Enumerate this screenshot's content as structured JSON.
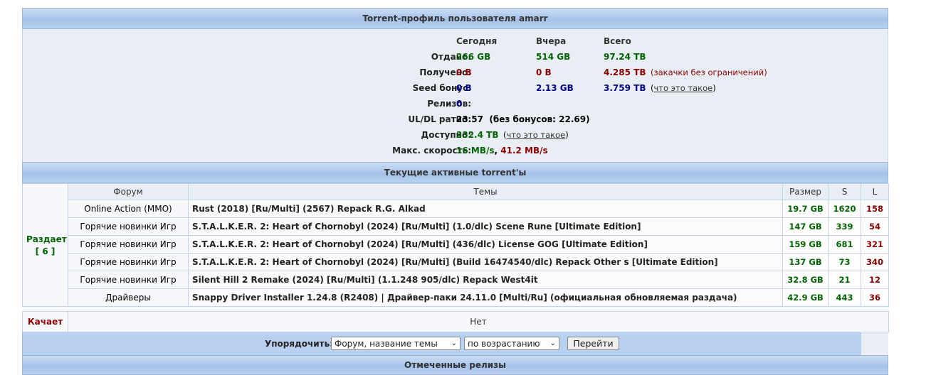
{
  "profile": {
    "title": "Torrent-профиль пользователя amarr",
    "headers": {
      "today": "Сегодня",
      "yesterday": "Вчера",
      "total": "Всего"
    },
    "uploaded": {
      "label": "Отдано:",
      "today": "266 GB",
      "yesterday": "514 GB",
      "total": "97.24 TB"
    },
    "downloaded": {
      "label": "Получено:",
      "today": "0 B",
      "yesterday": "0 B",
      "total": "4.285 TB",
      "note": "(закачки без ограничений)"
    },
    "seed_bonus": {
      "label": "Seed бонус:",
      "today": "0 B",
      "yesterday": "2.13 GB",
      "total": "3.759 TB",
      "note_open": "(",
      "note_link": "что это такое",
      "note_close": ")"
    },
    "releases": {
      "label": "Релизов:",
      "value": "0"
    },
    "ratio": {
      "label": "UL/DL ратио:",
      "value": "23.57",
      "extra": "(без бонусов: 22.69)"
    },
    "available": {
      "label": "Доступно:",
      "value": "332.4 TB",
      "note_open": "(",
      "note_link": "что это такое",
      "note_close": ")"
    },
    "max_speed": {
      "label": "Макс. скорость:",
      "up": "16 MB/s",
      "sep": ",",
      "down": "41.2 MB/s"
    }
  },
  "active": {
    "title": "Текущие активные torrent'ы",
    "columns": {
      "forum": "Форум",
      "topic": "Темы",
      "size": "Размер",
      "seeders": "S",
      "leechers": "L"
    },
    "seeding_label": "Раздает",
    "seeding_count": "[ 6 ]",
    "rows": [
      {
        "forum": "Online Action (MMO)",
        "topic": "Rust (2018) [Ru/Multi] (2567) Repack R.G. Alkad",
        "size": "19.7 GB",
        "s": "1620",
        "l": "158"
      },
      {
        "forum": "Горячие новинки Игр",
        "topic": "S.T.A.L.K.E.R. 2: Heart of Chornobyl (2024) [Ru/Multi] (1.0/dlc) Scene Rune [Ultimate Edition]",
        "size": "147 GB",
        "s": "339",
        "l": "54"
      },
      {
        "forum": "Горячие новинки Игр",
        "topic": "S.T.A.L.K.E.R. 2: Heart of Chornobyl (2024) [Ru/Multi] (436/dlc) License GOG [Ultimate Edition]",
        "size": "159 GB",
        "s": "681",
        "l": "321"
      },
      {
        "forum": "Горячие новинки Игр",
        "topic": "S.T.A.L.K.E.R. 2: Heart of Chornobyl (2024) [Ru/Multi] (Build 16474540/dlc) Repack Other s [Ultimate Edition]",
        "size": "137 GB",
        "s": "73",
        "l": "340"
      },
      {
        "forum": "Горячие новинки Игр",
        "topic": "Silent Hill 2 Remake (2024) [Ru/Multi] (1.1.248 905/dlc) Repack West4it",
        "size": "32.8 GB",
        "s": "21",
        "l": "12"
      },
      {
        "forum": "Драйверы",
        "topic": "Snappy Driver Installer 1.24.8 (R2408) | Драйвер-паки 24.11.0 [Multi/Ru] (официальная обновляемая раздача)",
        "size": "42.9 GB",
        "s": "443",
        "l": "36"
      }
    ],
    "leeching_label": "Качает",
    "leeching_value": "Нет"
  },
  "order": {
    "label": "Упорядочить:",
    "sort_field": "Форум, название темы",
    "sort_dir": "по возрастанию",
    "submit": "Перейти"
  },
  "marked": {
    "title": "Отмеченные релизы"
  },
  "colors": {
    "seed_green": "#006400",
    "leech_red": "#8b0000",
    "bonus_blue": "#00008b",
    "header_blue": "#afc9ec"
  }
}
